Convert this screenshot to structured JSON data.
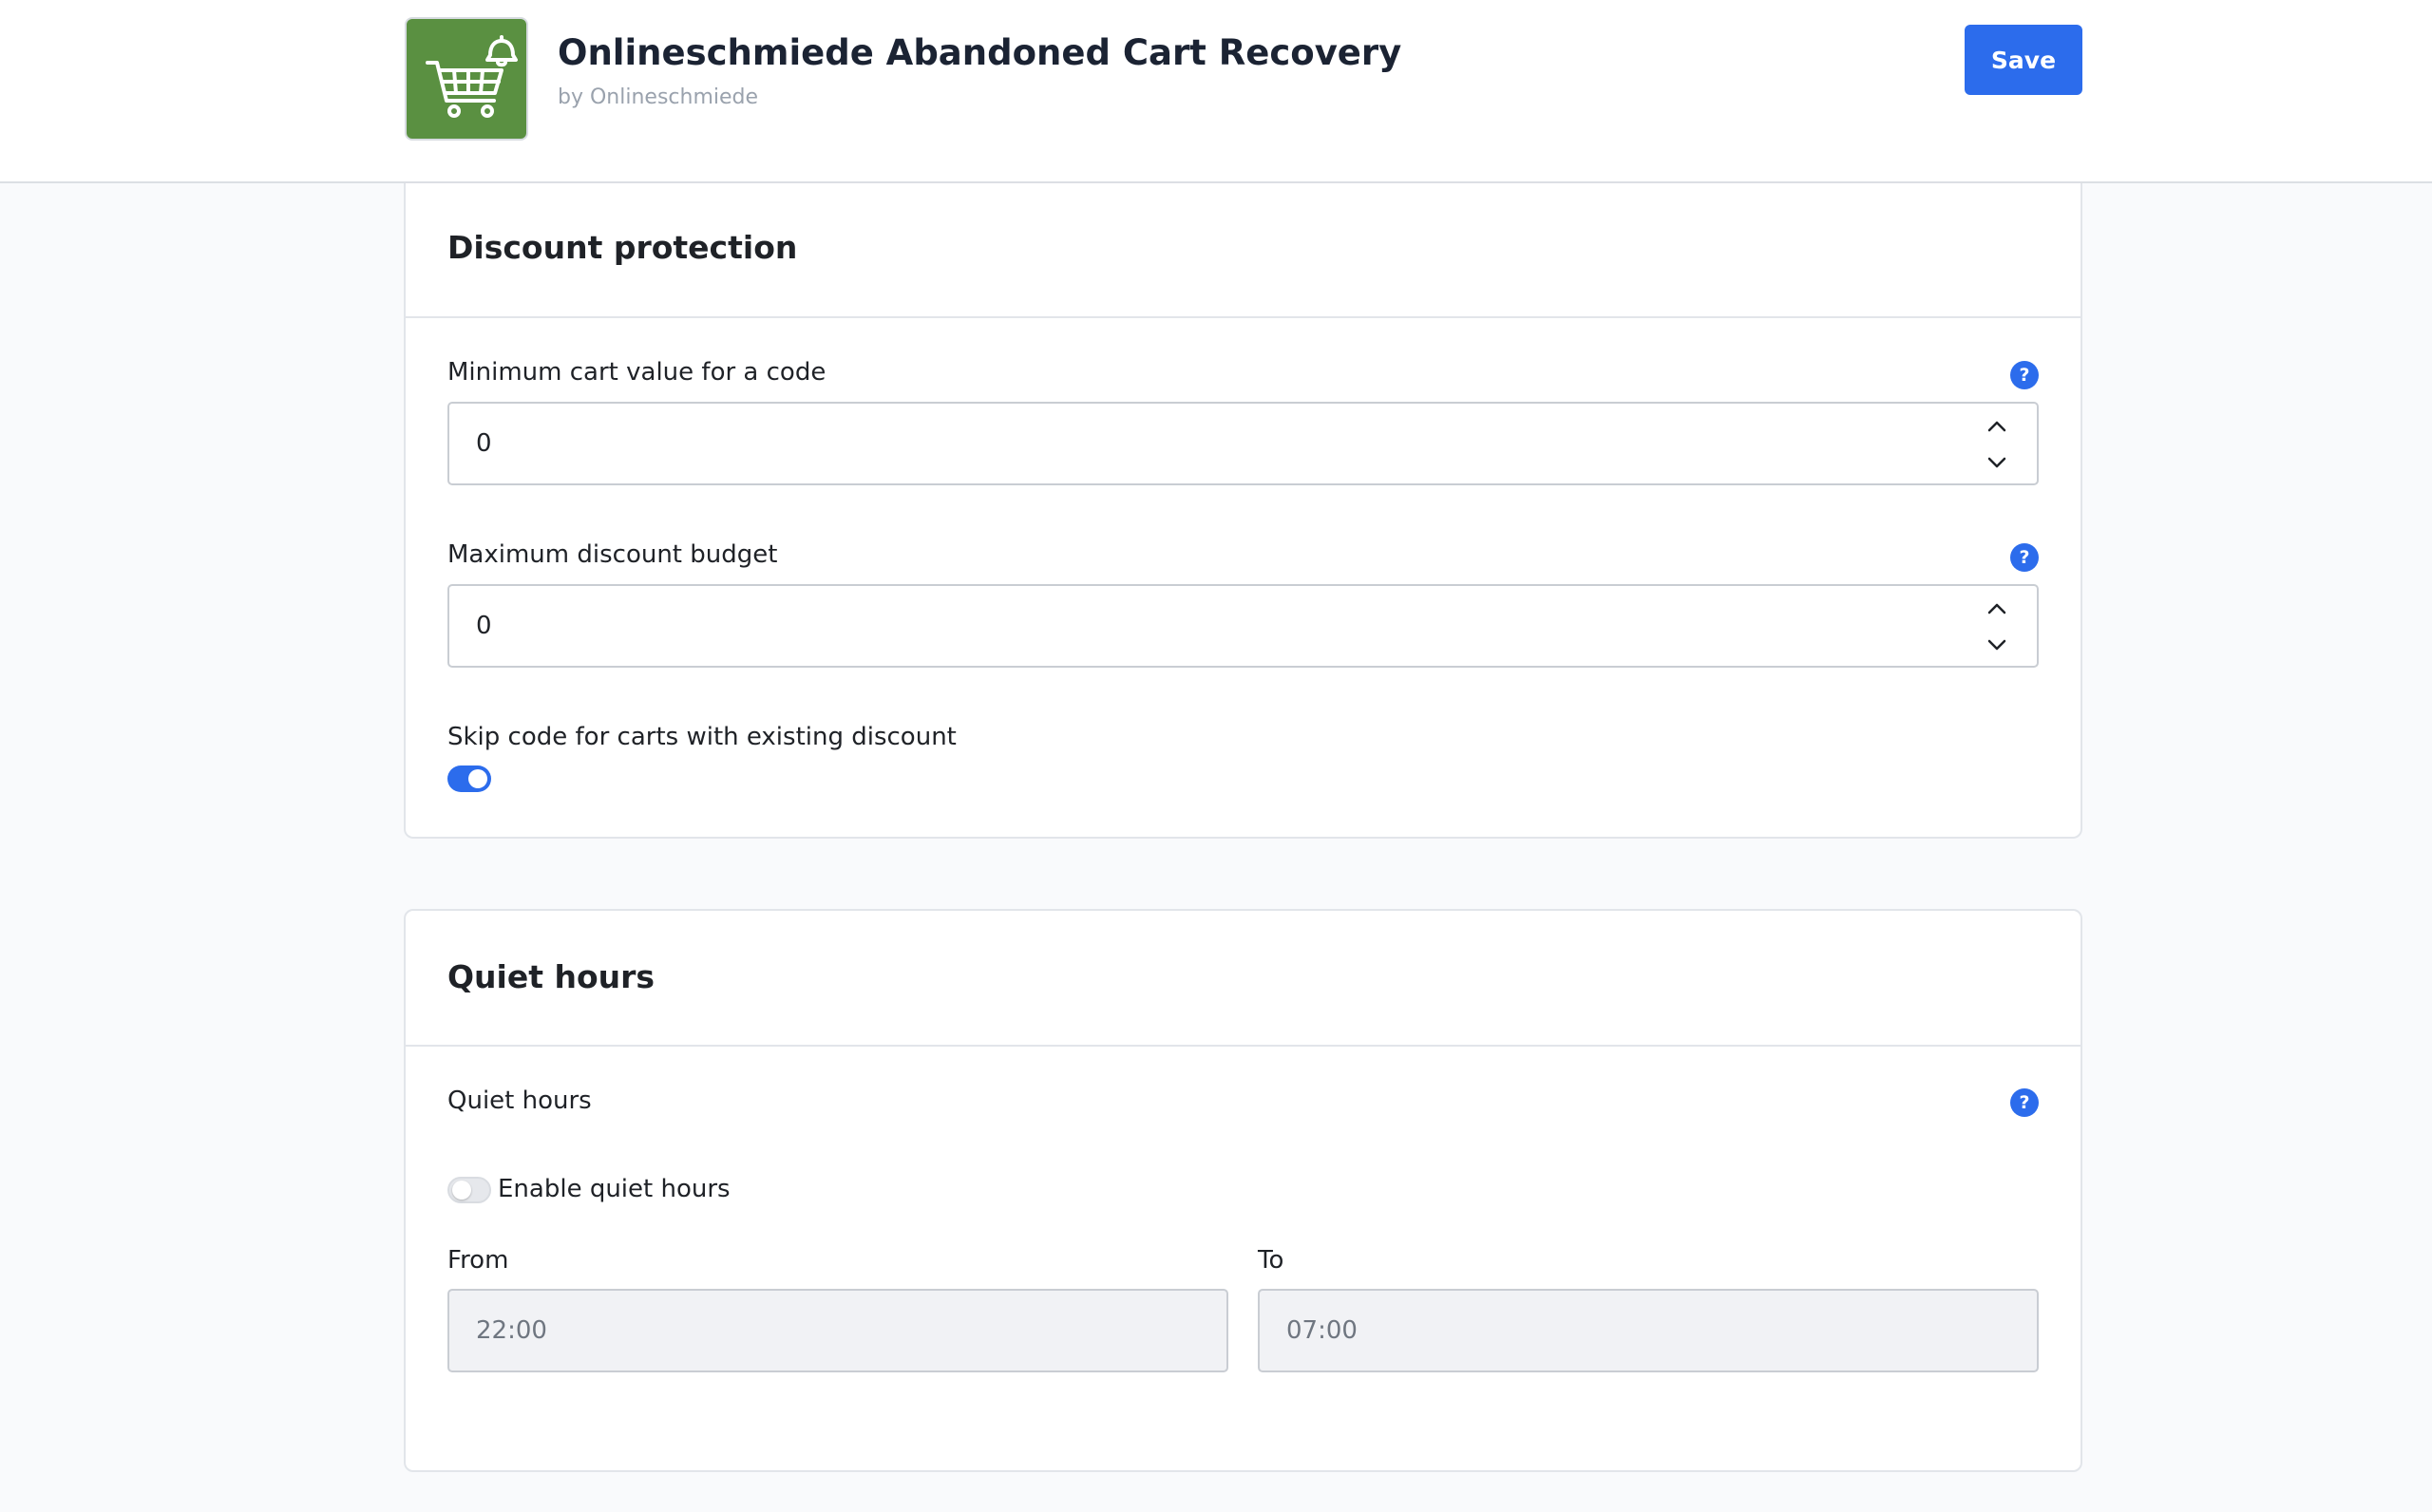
{
  "header": {
    "app_title": "Onlineschmiede Abandoned Cart Recovery",
    "vendor": "by Onlineschmiede",
    "save_label": "Save",
    "logo_icon": "shopping-cart-bell-icon",
    "logo_color": "#5a9041"
  },
  "accent_color": "#2c6cec",
  "discount_protection": {
    "title": "Discount protection",
    "min_cart_value": {
      "label": "Minimum cart value for a code",
      "value": "0"
    },
    "max_discount_budget": {
      "label": "Maximum discount budget",
      "value": "0"
    },
    "skip_existing_discount": {
      "label": "Skip code for carts with existing discount",
      "enabled": true
    }
  },
  "quiet_hours": {
    "title": "Quiet hours",
    "field_label": "Quiet hours",
    "enable_label": "Enable quiet hours",
    "enabled": false,
    "from_label": "From",
    "from_value": "22:00",
    "to_label": "To",
    "to_value": "07:00"
  },
  "icons": {
    "help": "question-mark-icon",
    "stepper_up": "chevron-up-icon",
    "stepper_down": "chevron-down-icon"
  }
}
